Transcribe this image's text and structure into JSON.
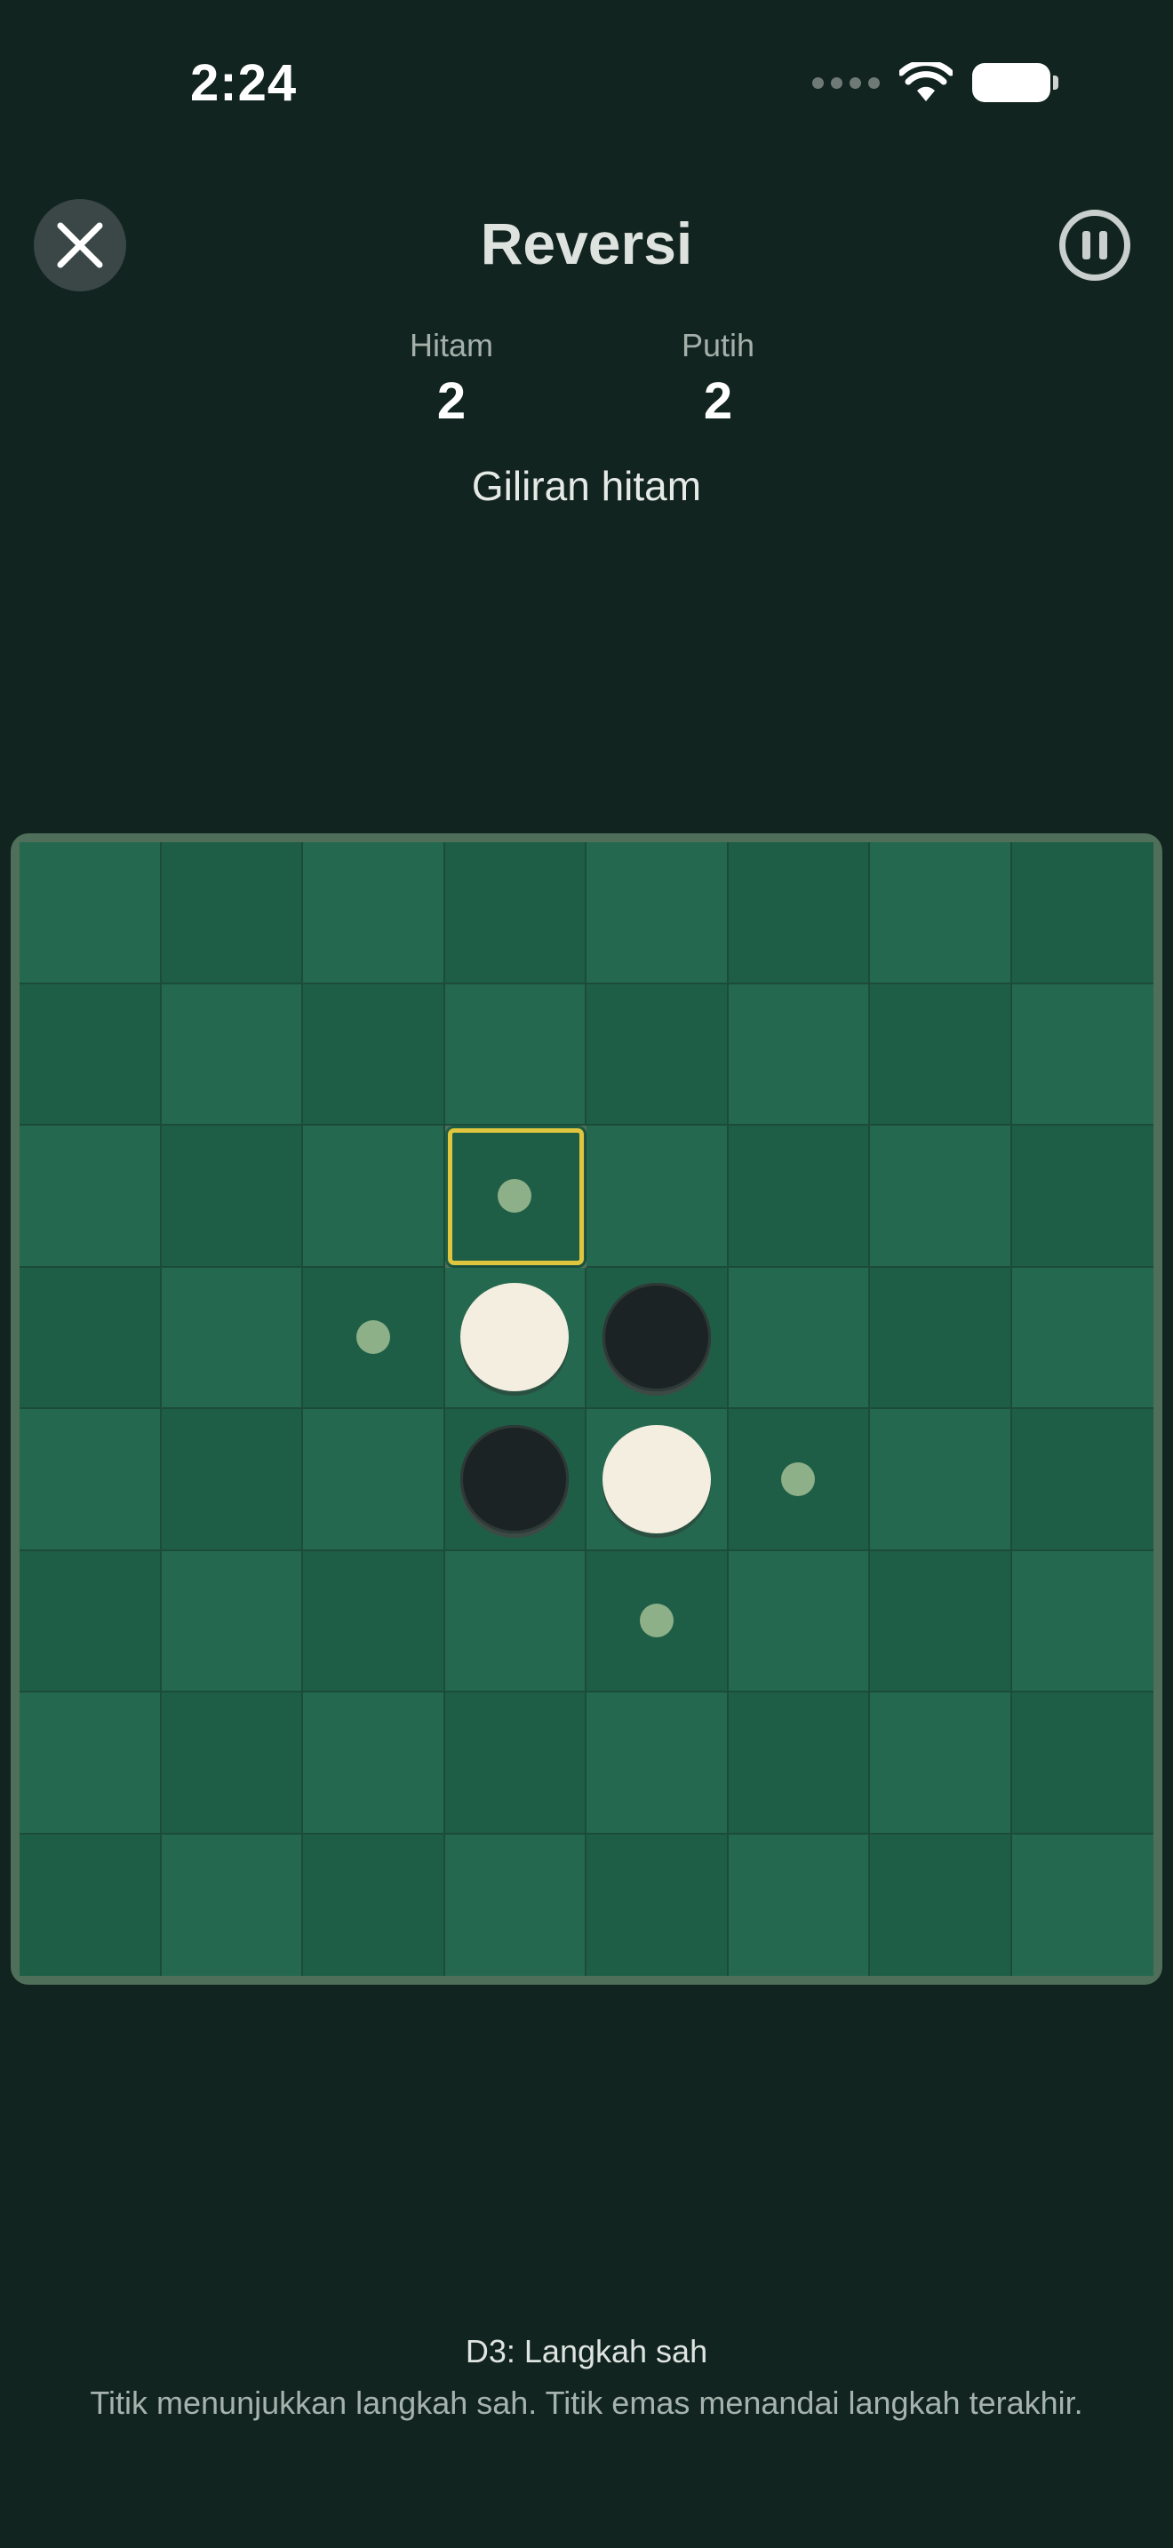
{
  "status_bar": {
    "time": "2:24",
    "icons": [
      "cellular-signal-icon",
      "wifi-icon",
      "battery-icon"
    ]
  },
  "header": {
    "title": "Reversi",
    "close_icon": "close-icon",
    "pause_icon": "pause-icon"
  },
  "score": {
    "black_label": "Hitam",
    "black_value": "2",
    "white_label": "Putih",
    "white_value": "2"
  },
  "turn_text": "Giliran hitam",
  "board": {
    "size": 8,
    "discs": [
      {
        "row": 3,
        "col": 3,
        "color": "white"
      },
      {
        "row": 3,
        "col": 4,
        "color": "black"
      },
      {
        "row": 4,
        "col": 3,
        "color": "black"
      },
      {
        "row": 4,
        "col": 4,
        "color": "white"
      }
    ],
    "legal_moves": [
      {
        "row": 2,
        "col": 3
      },
      {
        "row": 3,
        "col": 2
      },
      {
        "row": 4,
        "col": 5
      },
      {
        "row": 5,
        "col": 4
      }
    ],
    "last_move": {
      "row": 2,
      "col": 3
    },
    "colors": {
      "light_cell": "#24684f",
      "dark_cell": "#1f5e46",
      "highlight": "#e0c53e",
      "hint_dot": "#8db089"
    }
  },
  "footer": {
    "move_text": "D3: Langkah sah",
    "hint_text": "Titik menunjukkan langkah sah. Titik emas menandai langkah terakhir."
  }
}
